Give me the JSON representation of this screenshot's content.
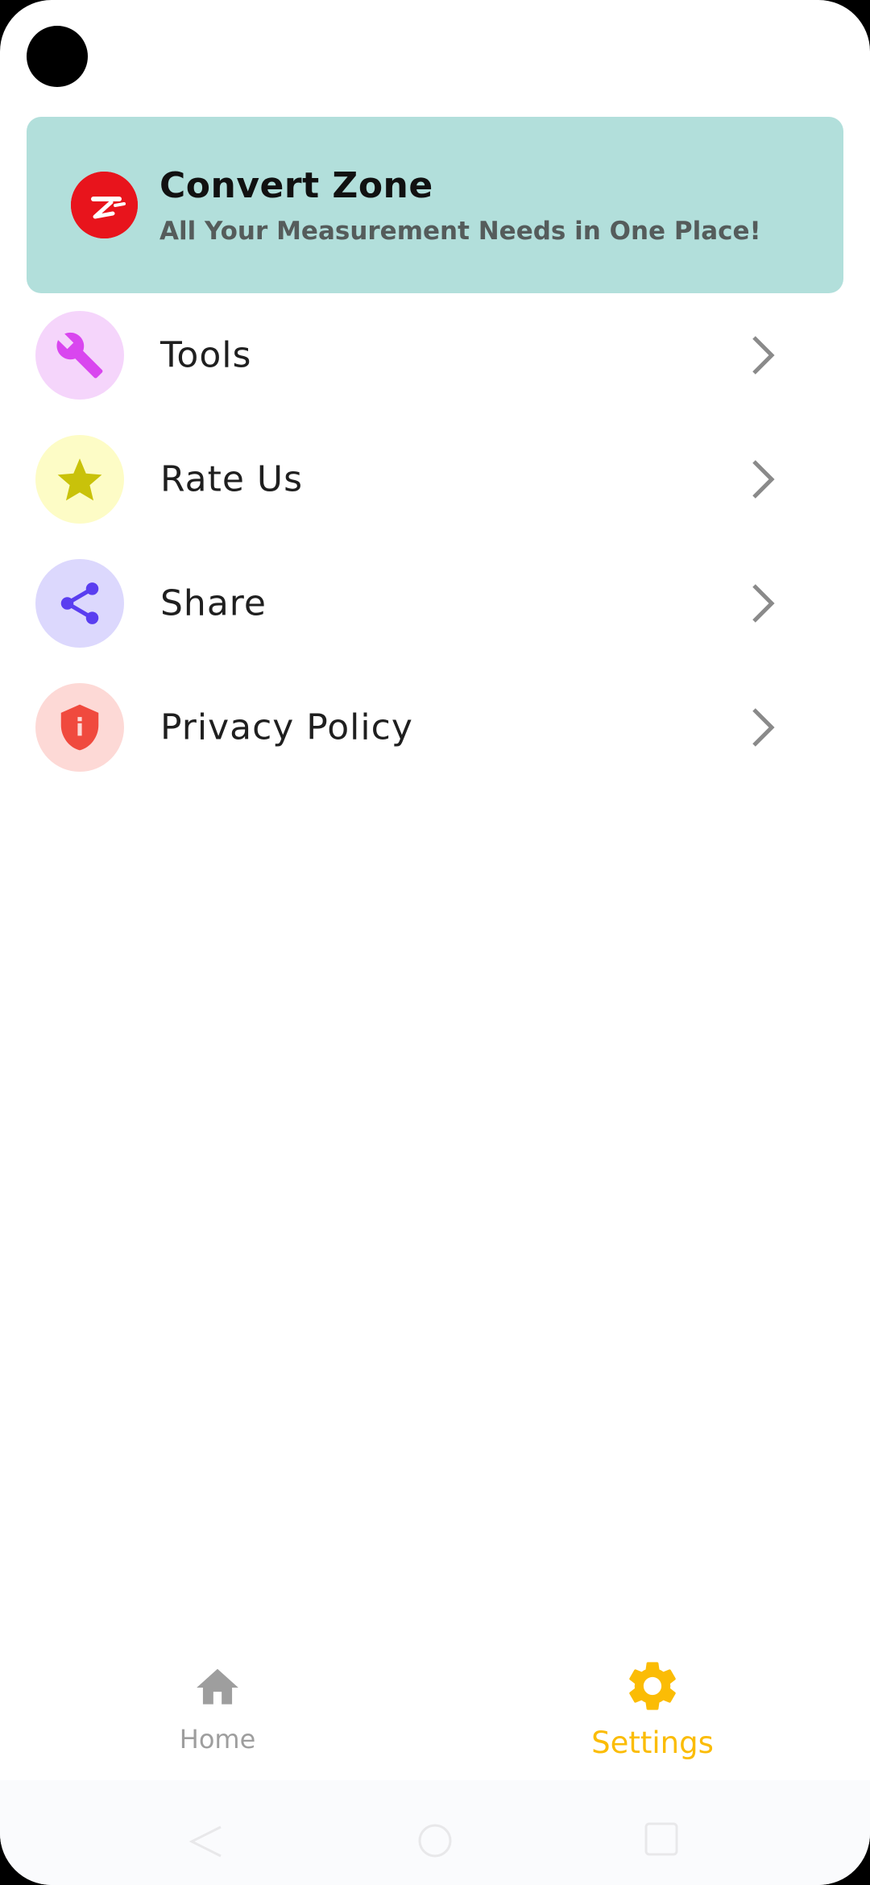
{
  "app": {
    "title": "Convert Zone",
    "subtitle": "All Your Measurement Needs in One Place!",
    "logo_icon": "convert-zone-logo",
    "brand_color": "#e8141c",
    "header_bg": "#b2dfdb"
  },
  "menu": {
    "items": [
      {
        "label": "Tools",
        "icon": "wrench-icon",
        "icon_color": "#d946ef",
        "icon_bg": "#f5d5fb"
      },
      {
        "label": "Rate Us",
        "icon": "star-icon",
        "icon_color": "#c9c20a",
        "icon_bg": "#fdfcc6"
      },
      {
        "label": "Share",
        "icon": "share-icon",
        "icon_color": "#5a3ef0",
        "icon_bg": "#dcd8fd"
      },
      {
        "label": "Privacy Policy",
        "icon": "shield-icon",
        "icon_color": "#f04a3e",
        "icon_bg": "#fdd9d6"
      }
    ],
    "chevron_icon": "chevron-right-icon"
  },
  "bottom_nav": {
    "tabs": [
      {
        "label": "Home",
        "icon": "home-icon",
        "active": false,
        "color": "#9e9e9e"
      },
      {
        "label": "Settings",
        "icon": "gear-icon",
        "active": true,
        "color": "#fbbc05"
      }
    ]
  },
  "system_nav": {
    "buttons": [
      "back-icon",
      "home-circle-icon",
      "recents-icon"
    ]
  }
}
